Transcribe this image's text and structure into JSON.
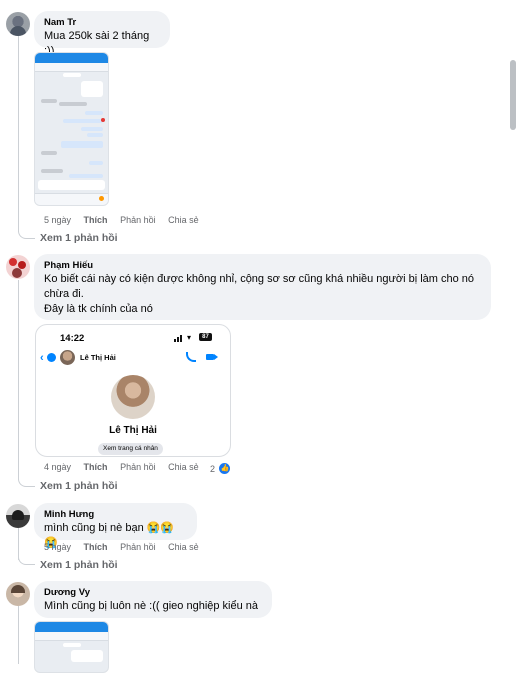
{
  "comments": [
    {
      "author": "Nam Tr",
      "text": "Mua 250k sài 2 tháng :))",
      "time": "5 ngày",
      "like": "Thích",
      "reply": "Phản hồi",
      "share": "Chia sẻ",
      "more_replies": "Xem 1 phản hồi"
    },
    {
      "author": "Phạm Hiếu",
      "text_line1": "Ko biết cái này có kiện được không nhỉ, cộng sơ sơ cũng khá nhiều người bị làm cho nó",
      "text_line2": "chừa đi.",
      "text_line3": "Đây là tk chính của nó",
      "time": "4 ngày",
      "like": "Thích",
      "reply": "Phản hồi",
      "share": "Chia sẻ",
      "reaction_count": "2",
      "more_replies": "Xem 1 phản hồi",
      "card": {
        "clock": "14:22",
        "battery": "87",
        "contact_name": "Lê Thị Hải",
        "profile_name": "Lê Thị Hải",
        "profile_button": "Xem trang cá nhân"
      }
    },
    {
      "author": "Minh Hưng",
      "text": "mình cũng bị nè bạn 😭😭😭",
      "time": "5 ngày",
      "like": "Thích",
      "reply": "Phản hồi",
      "share": "Chia sẻ",
      "more_replies": "Xem 1 phản hồi"
    },
    {
      "author": "Dương Vy",
      "text": "Mình cũng bị luôn nè :(( gieo nghiệp kiểu nà"
    }
  ],
  "colors": {
    "bubble": "#f0f2f5",
    "meta": "#65676b",
    "messenger_blue": "#0084ff",
    "like_blue": "#1877f2"
  }
}
